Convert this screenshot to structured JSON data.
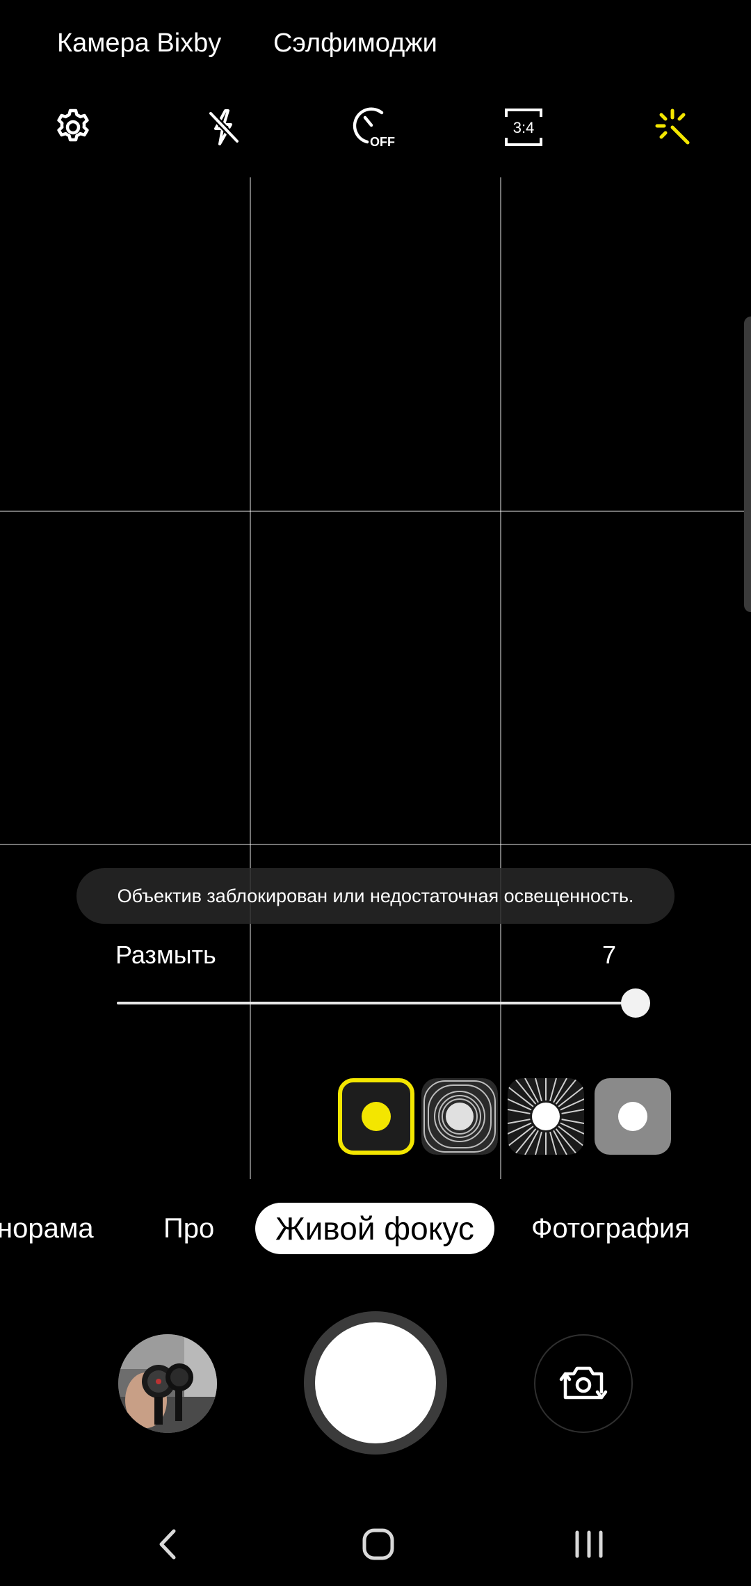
{
  "top_links": {
    "bixby": "Камера Bixby",
    "selfimoji": "Сэлфимоджи"
  },
  "toolbar": {
    "icons": [
      "settings-icon",
      "flash-off-icon",
      "timer-off-icon",
      "aspect-ratio-icon",
      "filters-icon"
    ],
    "aspect_ratio": "3:4",
    "timer_state": "OFF",
    "accent_color": "#f3e600"
  },
  "toast": {
    "message": "Объектив заблокирован или недостаточная освещенность."
  },
  "blur": {
    "label": "Размыть",
    "value": "7"
  },
  "effects": {
    "items": [
      "effect-blur",
      "effect-spin",
      "effect-zoom",
      "effect-color-point"
    ],
    "selected": "effect-blur"
  },
  "modes": {
    "items": [
      "норама",
      "Про",
      "Живой фокус",
      "Фотография"
    ],
    "active": "Живой фокус"
  },
  "nav": {
    "buttons": [
      "back-icon",
      "home-icon",
      "recents-icon"
    ]
  }
}
